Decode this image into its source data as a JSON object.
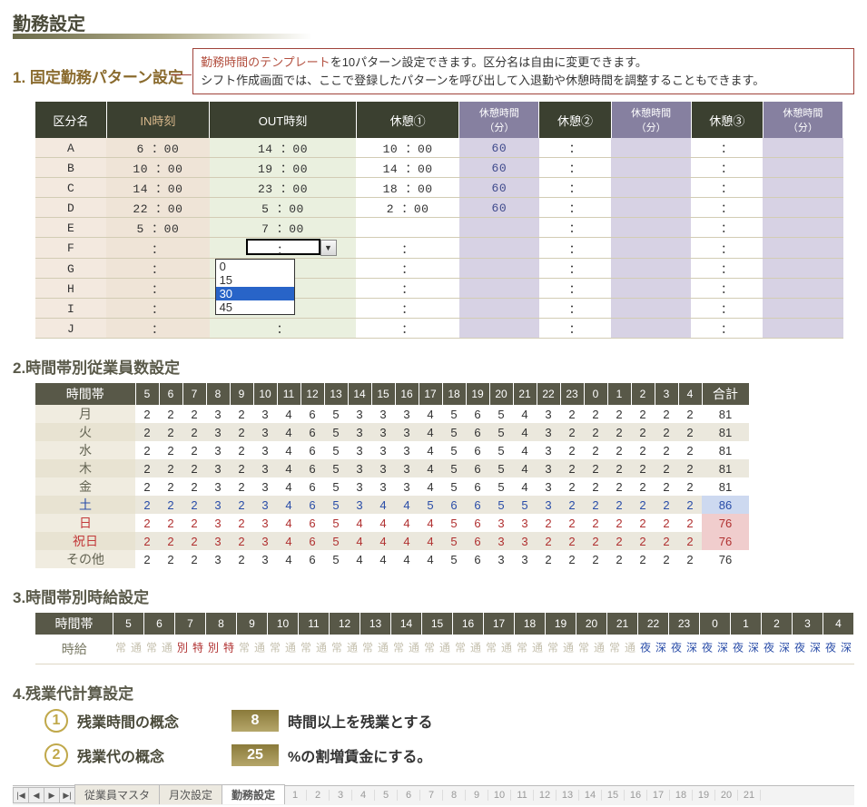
{
  "title": "勤務設定",
  "sec1": {
    "head": "1. 固定勤務パターン設定",
    "tip_hl": "勤務時間のテンプレート",
    "tip_l1": "を10パターン設定できます。区分名は自由に変更できます。",
    "tip_l2": "シフト作成画面では、ここで登録したパターンを呼び出して入退勤や休憩時間を調整することもできます。",
    "headers": [
      "区分名",
      "IN時刻",
      "OUT時刻",
      "休憩①",
      "休憩時間（分）",
      "休憩②",
      "休憩時間（分）",
      "休憩③",
      "休憩時間（分）"
    ],
    "rows": [
      {
        "n": "A",
        "in": "6 ：00",
        "out": "14 ：00",
        "b1": "10 ：00",
        "bt": "60",
        "b2": "：",
        "b3": "："
      },
      {
        "n": "B",
        "in": "10 ：00",
        "out": "19 ：00",
        "b1": "14 ：00",
        "bt": "60",
        "b2": "：",
        "b3": "："
      },
      {
        "n": "C",
        "in": "14 ：00",
        "out": "23 ：00",
        "b1": "18 ：00",
        "bt": "60",
        "b2": "：",
        "b3": "："
      },
      {
        "n": "D",
        "in": "22 ：00",
        "out": "5 ：00",
        "b1": "2 ：00",
        "bt": "60",
        "b2": "：",
        "b3": "："
      },
      {
        "n": "E",
        "in": "5 ：00",
        "out": "7 ：00",
        "b1": "",
        "bt": "",
        "b2": "：",
        "b3": "："
      },
      {
        "n": "F",
        "in": "：",
        "out": "",
        "b1": "：",
        "bt": "",
        "b2": "：",
        "b3": "：",
        "select": true
      },
      {
        "n": "G",
        "in": "：",
        "out": "：",
        "b1": "：",
        "bt": "",
        "b2": "：",
        "b3": "："
      },
      {
        "n": "H",
        "in": "：",
        "out": "：",
        "b1": "：",
        "bt": "",
        "b2": "：",
        "b3": "："
      },
      {
        "n": "I",
        "in": "：",
        "out": "：",
        "b1": "：",
        "bt": "",
        "b2": "：",
        "b3": "："
      },
      {
        "n": "J",
        "in": "：",
        "out": "：",
        "b1": "：",
        "bt": "",
        "b2": "：",
        "b3": "："
      }
    ],
    "dropdown": [
      "0",
      "15",
      "30",
      "45"
    ],
    "dropdown_selected": "30"
  },
  "sec2": {
    "head": "2.時間帯別従業員数設定",
    "h_first": "時間帯",
    "hours": [
      "5",
      "6",
      "7",
      "8",
      "9",
      "10",
      "11",
      "12",
      "13",
      "14",
      "15",
      "16",
      "17",
      "18",
      "19",
      "20",
      "21",
      "22",
      "23",
      "0",
      "1",
      "2",
      "3",
      "4"
    ],
    "h_total": "合計",
    "rows": [
      {
        "d": "月",
        "cls": "",
        "v": [
          2,
          2,
          2,
          3,
          2,
          3,
          4,
          6,
          5,
          3,
          3,
          3,
          4,
          5,
          6,
          5,
          4,
          3,
          2,
          2,
          2,
          2,
          2,
          2
        ],
        "t": 81
      },
      {
        "d": "火",
        "cls": "alt",
        "v": [
          2,
          2,
          2,
          3,
          2,
          3,
          4,
          6,
          5,
          3,
          3,
          3,
          4,
          5,
          6,
          5,
          4,
          3,
          2,
          2,
          2,
          2,
          2,
          2
        ],
        "t": 81
      },
      {
        "d": "水",
        "cls": "",
        "v": [
          2,
          2,
          2,
          3,
          2,
          3,
          4,
          6,
          5,
          3,
          3,
          3,
          4,
          5,
          6,
          5,
          4,
          3,
          2,
          2,
          2,
          2,
          2,
          2
        ],
        "t": 81
      },
      {
        "d": "木",
        "cls": "alt",
        "v": [
          2,
          2,
          2,
          3,
          2,
          3,
          4,
          6,
          5,
          3,
          3,
          3,
          4,
          5,
          6,
          5,
          4,
          3,
          2,
          2,
          2,
          2,
          2,
          2
        ],
        "t": 81
      },
      {
        "d": "金",
        "cls": "",
        "v": [
          2,
          2,
          2,
          3,
          2,
          3,
          4,
          6,
          5,
          3,
          3,
          3,
          4,
          5,
          6,
          5,
          4,
          3,
          2,
          2,
          2,
          2,
          2,
          2
        ],
        "t": 81
      },
      {
        "d": "土",
        "cls": "rsat alt",
        "v": [
          2,
          2,
          2,
          3,
          2,
          3,
          4,
          6,
          5,
          3,
          4,
          4,
          5,
          6,
          6,
          5,
          5,
          3,
          2,
          2,
          2,
          2,
          2,
          2
        ],
        "t": 86
      },
      {
        "d": "日",
        "cls": "rsun",
        "v": [
          2,
          2,
          2,
          3,
          2,
          3,
          4,
          6,
          5,
          4,
          4,
          4,
          4,
          5,
          6,
          3,
          3,
          2,
          2,
          2,
          2,
          2,
          2,
          2
        ],
        "t": 76
      },
      {
        "d": "祝日",
        "cls": "rhol alt",
        "v": [
          2,
          2,
          2,
          3,
          2,
          3,
          4,
          6,
          5,
          4,
          4,
          4,
          4,
          5,
          6,
          3,
          3,
          2,
          2,
          2,
          2,
          2,
          2,
          2
        ],
        "t": 76
      },
      {
        "d": "その他",
        "cls": "",
        "v": [
          2,
          2,
          2,
          3,
          2,
          3,
          4,
          6,
          5,
          4,
          4,
          4,
          4,
          5,
          6,
          3,
          3,
          2,
          2,
          2,
          2,
          2,
          2,
          2
        ],
        "t": 76
      }
    ]
  },
  "sec3": {
    "head": "3.時間帯別時給設定",
    "h_first": "時間帯",
    "row_lbl": "時給",
    "hours": [
      "5",
      "6",
      "7",
      "8",
      "9",
      "10",
      "11",
      "12",
      "13",
      "14",
      "15",
      "16",
      "17",
      "18",
      "19",
      "20",
      "21",
      "22",
      "23",
      "0",
      "1",
      "2",
      "3",
      "4"
    ],
    "rates": [
      "通常",
      "通常",
      "特別",
      "特別",
      "通常",
      "通常",
      "通常",
      "通常",
      "通常",
      "通常",
      "通常",
      "通常",
      "通常",
      "通常",
      "通常",
      "通常",
      "通常",
      "深夜",
      "深夜",
      "深夜",
      "深夜",
      "深夜",
      "深夜",
      "深夜"
    ],
    "rate_norm": "通常",
    "rate_spec": "特別",
    "rate_nite": "深夜"
  },
  "sec4": {
    "head": "4.残業代計算設定",
    "r1_n": "①",
    "r1_c": "残業時間の概念",
    "r1_v": "8",
    "r1_t": "時間以上を残業とする",
    "r2_n": "②",
    "r2_c": "残業代の概念",
    "r2_v": "25",
    "r2_t": "%の割増賃金にする。"
  },
  "tabs": {
    "t1": "従業員マスタ",
    "t2": "月次設定",
    "t3": "勤務設定",
    "nums": [
      "1",
      "2",
      "3",
      "4",
      "5",
      "6",
      "7",
      "8",
      "9",
      "10",
      "11",
      "12",
      "13",
      "14",
      "15",
      "16",
      "17",
      "18",
      "19",
      "20",
      "21"
    ]
  }
}
